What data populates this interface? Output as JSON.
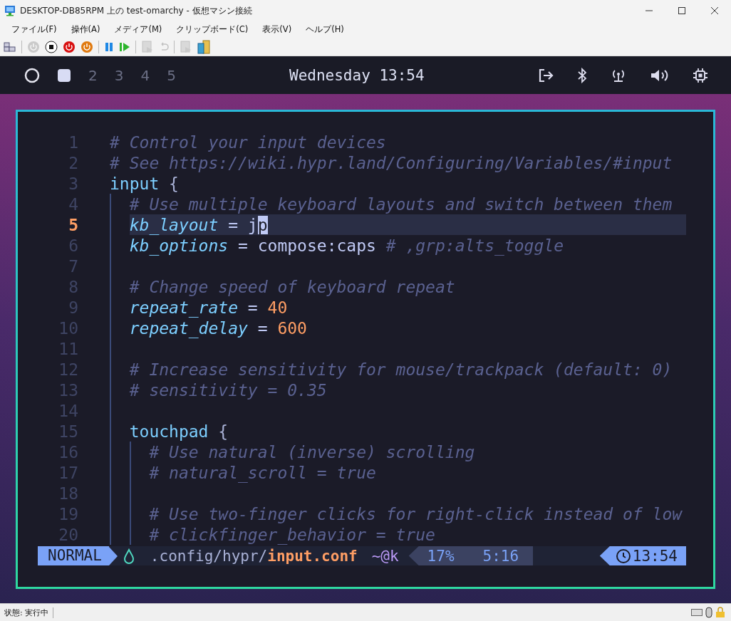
{
  "window": {
    "title": "DESKTOP-DB85RPM 上の test-omarchy  - 仮想マシン接続"
  },
  "menu": [
    "ファイル(F)",
    "操作(A)",
    "メディア(M)",
    "クリップボード(C)",
    "表示(V)",
    "ヘルプ(H)"
  ],
  "toolbar": [
    {
      "kind": "ctrl-alt-del",
      "disabled": false
    },
    {
      "kind": "sep"
    },
    {
      "kind": "start",
      "disabled": true
    },
    {
      "kind": "stop",
      "disabled": false
    },
    {
      "kind": "shutdown",
      "disabled": false
    },
    {
      "kind": "power",
      "disabled": false
    },
    {
      "kind": "sep"
    },
    {
      "kind": "pause",
      "disabled": false
    },
    {
      "kind": "resume",
      "disabled": false
    },
    {
      "kind": "sep"
    },
    {
      "kind": "checkpoint",
      "disabled": true
    },
    {
      "kind": "revert",
      "disabled": true
    },
    {
      "kind": "sep"
    },
    {
      "kind": "enhanced",
      "disabled": true
    },
    {
      "kind": "share",
      "disabled": false
    }
  ],
  "topbar": {
    "workspaces": [
      {
        "kind": "ring",
        "selected": true
      },
      {
        "kind": "square",
        "selected": false
      },
      {
        "label": "2",
        "kind": "number",
        "selected": false
      },
      {
        "label": "3",
        "kind": "number",
        "selected": false
      },
      {
        "label": "4",
        "kind": "number",
        "selected": false
      },
      {
        "label": "5",
        "kind": "number",
        "selected": false
      }
    ],
    "clock": "Wednesday 13:54",
    "tray": [
      {
        "kind": "logout"
      },
      {
        "kind": "bluetooth"
      },
      {
        "kind": "network"
      },
      {
        "kind": "volume"
      },
      {
        "kind": "cpu"
      }
    ]
  },
  "editor": {
    "lines": [
      {
        "number": "1",
        "current": false,
        "tokens": [
          {
            "kind": "comment",
            "text": "# Control your input devices"
          }
        ]
      },
      {
        "number": "2",
        "current": false,
        "tokens": [
          {
            "kind": "comment",
            "text": "# See https://wiki.hypr.land/Configuring/Variables/#input"
          }
        ]
      },
      {
        "number": "3",
        "current": false,
        "tokens": [
          {
            "kind": "section",
            "text": "input"
          },
          {
            "kind": "brace",
            "text": "{"
          }
        ],
        "children": [
          {
            "number": "4",
            "current": false,
            "tokens": [
              {
                "kind": "comment",
                "text": "# Use multiple keyboard layouts and switch between them"
              }
            ]
          },
          {
            "number": "5",
            "current": true,
            "tokens": [
              {
                "kind": "key",
                "text": "kb_layout"
              },
              {
                "kind": "plain",
                "text": " = j"
              },
              {
                "kind": "cursor",
                "text": "p"
              }
            ]
          },
          {
            "number": "6",
            "current": false,
            "tokens": [
              {
                "kind": "key",
                "text": "kb_options"
              },
              {
                "kind": "plain",
                "text": " = compose:caps "
              },
              {
                "kind": "comment",
                "text": "# ,grp:alts_toggle"
              }
            ]
          },
          {
            "number": "7",
            "current": false
          },
          {
            "number": "8",
            "current": false,
            "tokens": [
              {
                "kind": "comment",
                "text": "# Change speed of keyboard repeat"
              }
            ]
          },
          {
            "number": "9",
            "current": false,
            "tokens": [
              {
                "kind": "key",
                "text": "repeat_rate"
              },
              {
                "kind": "plain",
                "text": " = "
              },
              {
                "kind": "num",
                "text": "40"
              }
            ]
          },
          {
            "number": "10",
            "current": false,
            "tokens": [
              {
                "kind": "key",
                "text": "repeat_delay"
              },
              {
                "kind": "plain",
                "text": " = "
              },
              {
                "kind": "num",
                "text": "600"
              }
            ]
          },
          {
            "number": "11",
            "current": false
          },
          {
            "number": "12",
            "current": false,
            "tokens": [
              {
                "kind": "comment",
                "text": "# Increase sensitivity for mouse/trackpack (default: 0)"
              }
            ]
          },
          {
            "number": "13",
            "current": false,
            "tokens": [
              {
                "kind": "comment",
                "text": "# sensitivity = 0.35"
              }
            ]
          },
          {
            "number": "14",
            "current": false
          },
          {
            "number": "15",
            "current": false,
            "tokens": [
              {
                "kind": "section",
                "text": "touchpad"
              },
              {
                "kind": "brace",
                "text": "{"
              }
            ],
            "children": [
              {
                "number": "16",
                "current": false,
                "tokens": [
                  {
                    "kind": "comment",
                    "text": "# Use natural (inverse) scrolling"
                  }
                ]
              },
              {
                "number": "17",
                "current": false,
                "tokens": [
                  {
                    "kind": "comment",
                    "text": "# natural_scroll = true"
                  }
                ]
              },
              {
                "number": "18",
                "current": false
              },
              {
                "number": "19",
                "current": false,
                "tokens": [
                  {
                    "kind": "comment",
                    "text": "# Use two-finger clicks for right-click instead of low"
                  }
                ]
              },
              {
                "number": "20",
                "current": false,
                "tokens": [
                  {
                    "kind": "comment",
                    "text": "# clickfinger_behavior = true"
                  }
                ]
              }
            ]
          }
        ]
      }
    ]
  },
  "statusline": {
    "mode": "NORMAL",
    "path": ".config/hypr/",
    "file": "input.conf",
    "flags": "~@k",
    "percent": "17%",
    "position": "5:16",
    "time": "13:54"
  },
  "status_bar": {
    "text": "状態: 実行中"
  }
}
